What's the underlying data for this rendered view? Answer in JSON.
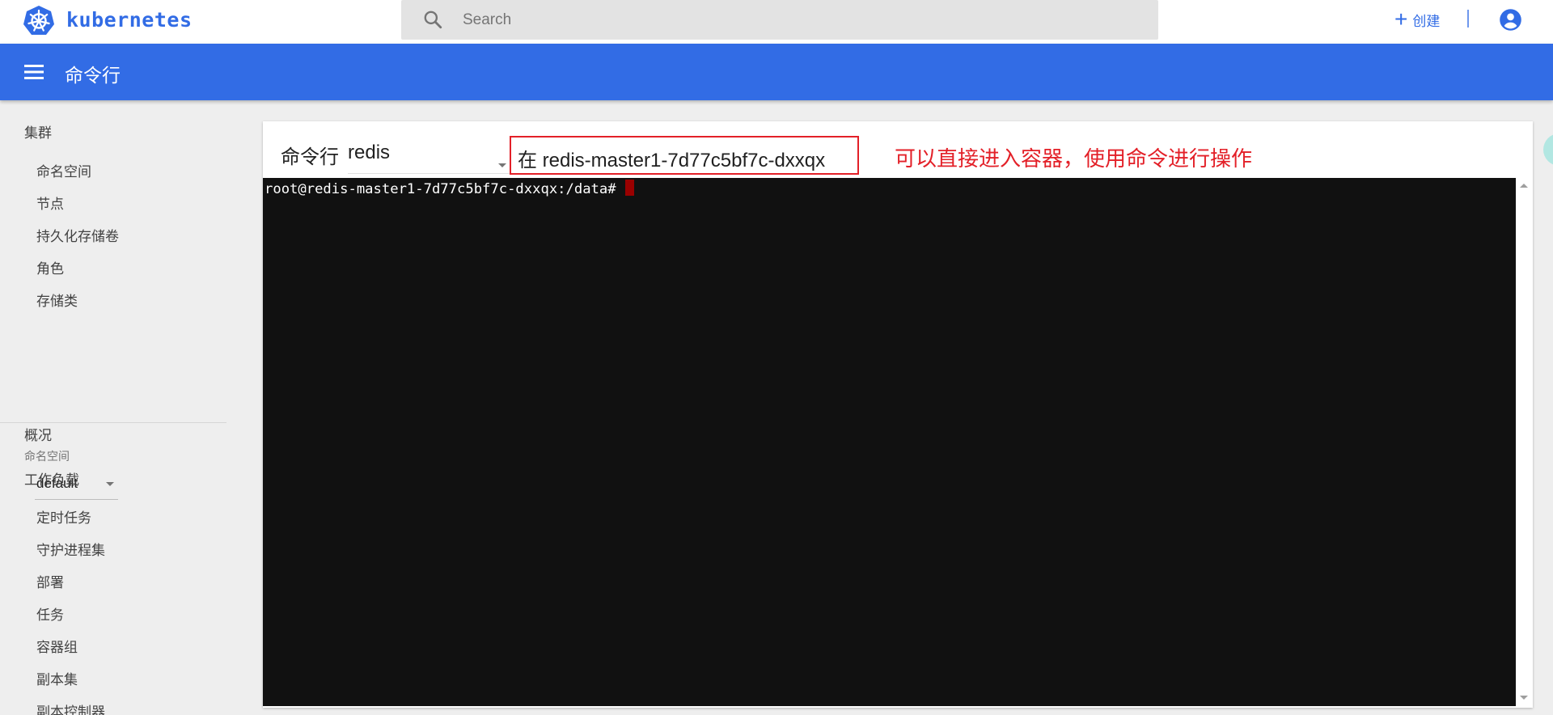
{
  "brand": {
    "name": "kubernetes",
    "logo_icon": "kubernetes-helm-icon",
    "color": "#326ce5"
  },
  "search": {
    "placeholder": "Search",
    "icon": "search-icon"
  },
  "topbar": {
    "create_label": "创建",
    "create_icon": "plus-icon",
    "account_icon": "account-circle-icon"
  },
  "titlebar": {
    "title": "命令行",
    "menu_icon": "hamburger-menu-icon",
    "background": "#326ce5"
  },
  "sidebar": {
    "cluster": {
      "label": "集群",
      "items": [
        "命名空间",
        "节点",
        "持久化存储卷",
        "角色",
        "存储类"
      ]
    },
    "namespace": {
      "label": "命名空间",
      "selected": "default"
    },
    "overview": "概况",
    "workloads": {
      "label": "工作负载",
      "items": [
        "定时任务",
        "守护进程集",
        "部署",
        "任务",
        "容器组",
        "副本集",
        "副本控制器"
      ]
    }
  },
  "shell": {
    "label": "命令行",
    "pod": "redis",
    "container": "在 redis-master1-7d77c5bf7c-dxxqx",
    "annotation": "可以直接进入容器，使用命令进行操作",
    "annotation_color": "#e32028",
    "prompt": "root@redis-master1-7d77c5bf7c-dxxqx:/data#"
  }
}
